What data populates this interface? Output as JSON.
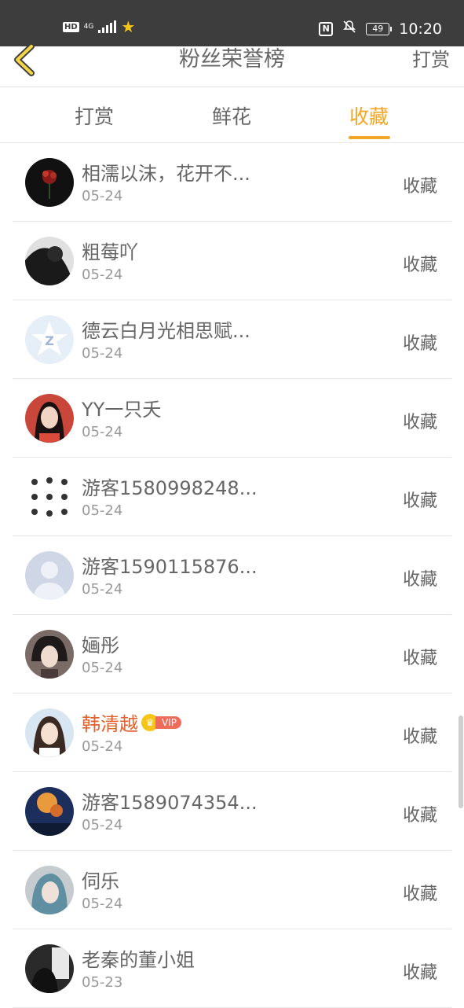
{
  "status_bar": {
    "hd": "HD",
    "network": "4G",
    "battery": "49",
    "time": "10:20"
  },
  "header": {
    "title": "粉丝荣誉榜",
    "action": "打赏"
  },
  "tabs": [
    {
      "label": "打赏"
    },
    {
      "label": "鲜花"
    },
    {
      "label": "收藏",
      "active": true
    }
  ],
  "accent_color": "#f5a623",
  "list": [
    {
      "name": "相濡以沫，花开不...",
      "date": "05-24",
      "action": "收藏"
    },
    {
      "name": "粗莓吖",
      "date": "05-24",
      "action": "收藏"
    },
    {
      "name": "德云白月光相思赋...",
      "date": "05-24",
      "action": "收藏"
    },
    {
      "name": "YY一只夭",
      "date": "05-24",
      "action": "收藏"
    },
    {
      "name": "游客1580998248...",
      "date": "05-24",
      "action": "收藏"
    },
    {
      "name": "游客1590115876...",
      "date": "05-24",
      "action": "收藏"
    },
    {
      "name": "婳彤",
      "date": "05-24",
      "action": "收藏"
    },
    {
      "name": "韩清越",
      "date": "05-24",
      "action": "收藏",
      "vip": "VIP"
    },
    {
      "name": "游客1589074354...",
      "date": "05-24",
      "action": "收藏"
    },
    {
      "name": "伺乐",
      "date": "05-24",
      "action": "收藏"
    },
    {
      "name": "老秦的董小姐",
      "date": "05-23",
      "action": "收藏"
    }
  ]
}
